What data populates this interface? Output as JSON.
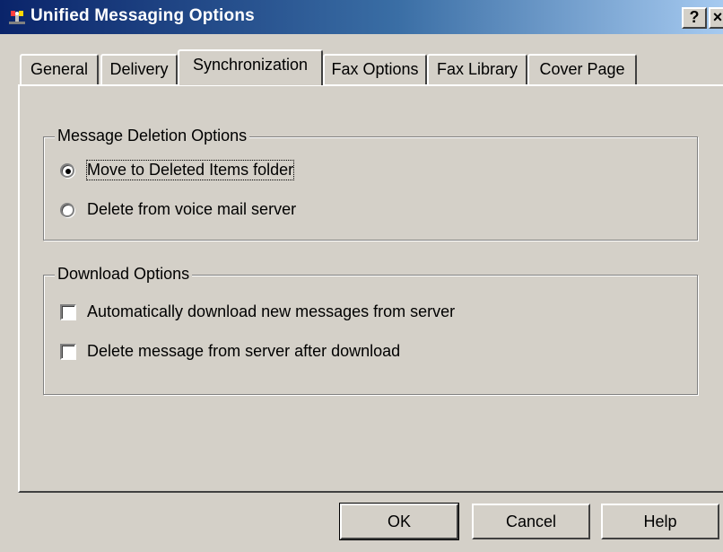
{
  "window": {
    "title": "Unified Messaging Options",
    "help_glyph": "?",
    "close_glyph": "×"
  },
  "tabs": [
    {
      "label": "General",
      "active": false
    },
    {
      "label": "Delivery",
      "active": false
    },
    {
      "label": "Synchronization",
      "active": true
    },
    {
      "label": "Fax Options",
      "active": false
    },
    {
      "label": "Fax Library",
      "active": false
    },
    {
      "label": "Cover Page",
      "active": false
    }
  ],
  "deletion": {
    "title": "Message Deletion Options",
    "options": [
      {
        "label": "Move to Deleted Items folder",
        "selected": true
      },
      {
        "label": "Delete from voice mail server",
        "selected": false
      }
    ]
  },
  "download": {
    "title": "Download Options",
    "options": [
      {
        "label": "Automatically download new messages from server",
        "checked": false
      },
      {
        "label": "Delete message from server after download",
        "checked": false
      }
    ]
  },
  "buttons": {
    "ok": "OK",
    "cancel": "Cancel",
    "help": "Help"
  },
  "colors": {
    "dialog_face": "#d4d0c8",
    "title_start": "#0a246a",
    "title_end": "#a6caf0"
  },
  "icons": {
    "app": "satellite-antenna-icon",
    "help": "help-question-icon",
    "close": "close-icon"
  }
}
